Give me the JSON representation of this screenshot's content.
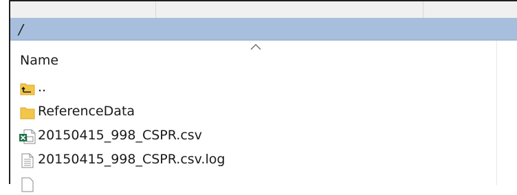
{
  "path_bar": {
    "path": "/"
  },
  "columns": {
    "name": "Name"
  },
  "files": [
    {
      "name": "..",
      "icon": "folder-up-icon"
    },
    {
      "name": "ReferenceData",
      "icon": "folder-icon"
    },
    {
      "name": "20150415_998_CSPR.csv",
      "icon": "excel-csv-icon"
    },
    {
      "name": "20150415_998_CSPR.csv.log",
      "icon": "text-file-icon"
    }
  ],
  "colors": {
    "path_bar_bg": "#a7bfdc",
    "folder": "#f3c64a",
    "excel": "#1e7145"
  }
}
